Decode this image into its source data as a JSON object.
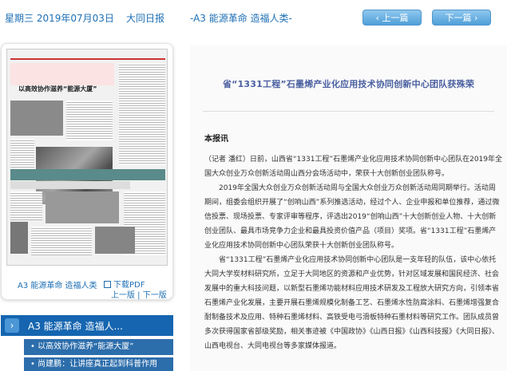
{
  "header": {
    "date": "星期三 2019年07月03日",
    "paper": "大同日报",
    "page": "-A3 能源革命 造福人类-",
    "prev_label": "上一篇",
    "next_label": "下一篇"
  },
  "thumbnail": {
    "headline": "以高效协作滋养“能源大厦”",
    "band_text": "石墨烯产业化应用技术协同"
  },
  "left_panel": {
    "page_name": "A3 能源革命 造福人类",
    "pdf_label": "下载PDF",
    "page_nav": "上一版 | 下一版"
  },
  "sidebar": {
    "header_title": "A3  能源革命 造福人...",
    "items": [
      {
        "label": "• 以高效协作滋养“能源大厦”"
      },
      {
        "label": "• 尚建鹏：让讲座真正起到科普作用"
      }
    ]
  },
  "article": {
    "title": "省“1331工程”石墨烯产业化应用技术协同创新中心团队获殊荣",
    "byline": "本报讯",
    "paragraphs": [
      "（记者 潘红）日前，山西省“1331工程”石墨烯产业化应用技术协同创新中心团队在2019年全国大众创业万众创新活动周山西分会场活动中，荣获十大创新创业团队称号。",
      "2019年全国大众创业万众创新活动周与全国大众创业万众创新活动周同期举行。活动周期间，组委会组织开展了“创响山西”系列推选活动，经过个人、企业申报和单位推荐，通过微信投票、现场投票、专家评审等程序，评选出2019“创响山西”十大创新创业人物、十大创新创业团队、最具市场竞争力企业和最具投资价值产品（项目）奖项。省“1331工程”石墨烯产业化应用技术协同创新中心团队荣获十大创新创业团队称号。",
      "省“1331工程”石墨烯产业化应用技术协同创新中心团队是一支年轻的队伍，该中心依托大同大学炭材料研究所，立足于大同地区的资源和产业优势，针对区域发展和国民经济、社会发展中的重大科技问题，以新型石墨烯功能材料应用技术研发及工程放大研究方向，引领本省石墨烯产业化发展，主要开展石墨烯规模化制备工艺、石墨烯水性防腐涂料、石墨烯增强复合耐制备技术及应用、特种石墨烯材料、高铁受电弓滑板特种石墨材料等研究工作。团队成员曾多次获得国家省部级奖励，相关事迹被《中国政协》《山西日报》《山西科技报》《大同日报》、山西电视台、大同电视台等多家媒体报道。"
    ]
  },
  "colors": {
    "accent": "#1e6fb4",
    "sidebar_bg": "#1565b0",
    "title_color": "#4a5fa0"
  }
}
